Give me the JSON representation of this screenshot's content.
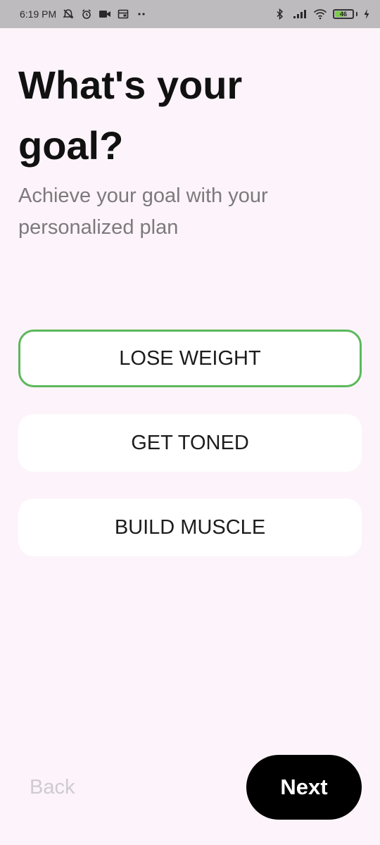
{
  "status_bar": {
    "time": "6:19 PM",
    "left_icons": [
      "alarm-off-icon",
      "alarm-clock-icon",
      "video-camera-icon",
      "calendar-icon",
      "more-dots-icon"
    ],
    "right_icons": [
      "bluetooth-icon",
      "signal-icon",
      "wifi-icon",
      "battery-icon",
      "charging-icon"
    ],
    "battery_level": "46",
    "battery_fraction": 0.46,
    "battery_color": "#7ccb4a"
  },
  "page": {
    "title": "What's your goal?",
    "subtitle": "Achieve your goal with your personalized plan"
  },
  "options": [
    {
      "label": "LOSE WEIGHT",
      "selected": true
    },
    {
      "label": "GET TONED",
      "selected": false
    },
    {
      "label": "BUILD MUSCLE",
      "selected": false
    }
  ],
  "navigation": {
    "back_label": "Back",
    "next_label": "Next"
  },
  "colors": {
    "background": "#fcf4fa",
    "status_bar": "#bdbbbd",
    "selected_border": "#5cb85c",
    "next_button": "#000000",
    "back_text": "#cfcbd0",
    "subtitle_text": "#7c7a7d"
  }
}
